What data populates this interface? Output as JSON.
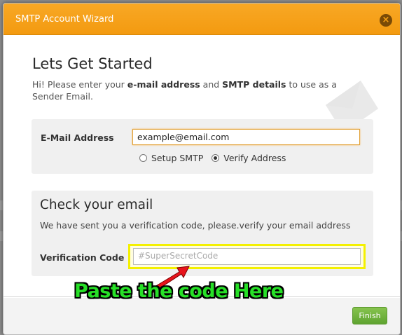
{
  "window": {
    "title": "SMTP Account Wizard",
    "close_icon": "close-icon",
    "close_glyph": "×"
  },
  "intro": {
    "heading": "Lets Get Started",
    "text_parts": [
      "Hi! Please enter your ",
      "e-mail address",
      " and ",
      "SMTP details",
      " to use as a Sender Email."
    ],
    "decoration_icon": "envelope-icon"
  },
  "email_section": {
    "label": "E-Mail Address",
    "value": "example@email.com",
    "options": [
      {
        "label": "Setup SMTP",
        "selected": false
      },
      {
        "label": "Verify Address",
        "selected": true
      }
    ]
  },
  "verify_section": {
    "heading": "Check your email",
    "description": "We have sent you a verification code, please.verify your email address",
    "code_label": "Verification Code",
    "code_placeholder": "#SuperSecretCode"
  },
  "annotation": {
    "text": "Paste the code Here",
    "text_color": "#27e027",
    "highlight_color": "#f4f000",
    "arrow_color": "#e8141c"
  },
  "footer": {
    "finish_label": "Finish"
  },
  "colors": {
    "titlebar": "#f6a014",
    "finish_button": "#6aae38"
  }
}
